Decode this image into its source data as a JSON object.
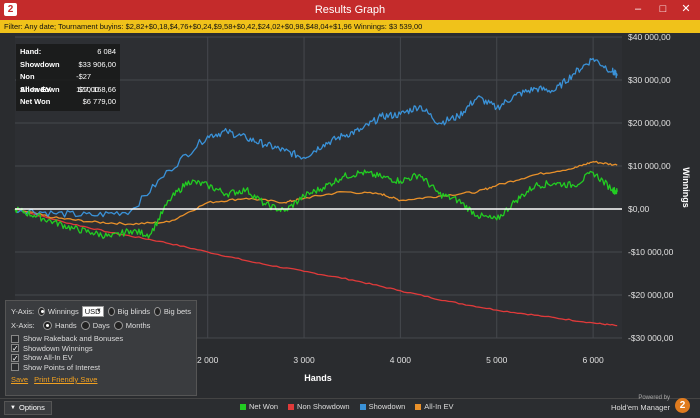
{
  "window": {
    "app_icon": "2",
    "title": "Results Graph",
    "controls": [
      "–",
      "□",
      "✕"
    ]
  },
  "filter": {
    "text": "Filter: Any date; Tournament buyins: $2,82+$0,18,$4,76+$0,24,$9,58+$0,42,$24,02+$0,98,$48,04+$1,96 Winnings: $3 539,00"
  },
  "stats": [
    {
      "label": "Hand:",
      "value": "6 084"
    },
    {
      "label": "Showdown",
      "value": "$33 906,00"
    },
    {
      "label": "Non Showdown",
      "value": "-$27 127,00"
    },
    {
      "label": "All-In EV",
      "value": "$10 168,66"
    },
    {
      "label": "Net Won",
      "value": "$6 779,00"
    }
  ],
  "options": {
    "y_axis_label": "Y-Axis:",
    "y_winnings": "Winnings",
    "currency": "USD",
    "y_big_blinds": "Big blinds",
    "y_big_bets": "Big bets",
    "x_axis_label": "X-Axis:",
    "x_hands": "Hands",
    "x_days": "Days",
    "x_months": "Months",
    "checks": [
      {
        "label": "Show Rakeback and Bonuses",
        "checked": false
      },
      {
        "label": "Showdown Winnings",
        "checked": true
      },
      {
        "label": "Show All-In EV",
        "checked": true
      },
      {
        "label": "Show Points of Interest",
        "checked": false
      }
    ],
    "save": "Save",
    "print": "Print Friendly Save"
  },
  "footer": {
    "options_button": "Options",
    "powered_by": "Powered by",
    "brand_name": "Hold'em Manager",
    "brand_logo": "2"
  },
  "colors": {
    "net_won": "#22cc22",
    "non_showdown": "#e03a3a",
    "showdown": "#3a92d8",
    "allin_ev": "#e8902a",
    "zero_line": "#ffffff"
  },
  "chart_data": {
    "type": "line",
    "xlabel": "Hands",
    "ylabel": "Winnings",
    "xlim": [
      0,
      6300
    ],
    "ylim": [
      -30000,
      40000
    ],
    "x_ticks": [
      2000,
      3000,
      4000,
      5000,
      6000
    ],
    "x_tick_labels": [
      "2 000",
      "3 000",
      "4 000",
      "5 000",
      "6 000"
    ],
    "y_ticks": [
      -30000,
      -20000,
      -10000,
      0,
      10000,
      20000,
      30000,
      40000
    ],
    "y_tick_labels": [
      "-$30 000,00",
      "-$20 000,00",
      "-$10 000,00",
      "$0,00",
      "$10 000,00",
      "$20 000,00",
      "$30 000,00",
      "$40 000,00"
    ],
    "grid": true,
    "legend_position": "bottom",
    "series": [
      {
        "name": "Net Won",
        "color": "#22cc22",
        "x": [
          0,
          200,
          400,
          600,
          800,
          1000,
          1200,
          1400,
          1600,
          1800,
          2000,
          2200,
          2400,
          2600,
          2800,
          3000,
          3200,
          3400,
          3600,
          3800,
          4000,
          4200,
          4400,
          4600,
          4800,
          5000,
          5200,
          5400,
          5600,
          5800,
          6000,
          6200,
          6250
        ],
        "y": [
          0,
          -1500,
          -3000,
          -4500,
          -5500,
          -6500,
          -5000,
          -6000,
          2000,
          6500,
          5500,
          3500,
          4500,
          1000,
          -500,
          3000,
          5000,
          7500,
          8500,
          7500,
          6500,
          8000,
          3500,
          2000,
          -1500,
          -2500,
          2000,
          5500,
          6000,
          5500,
          8500,
          4500,
          4000
        ]
      },
      {
        "name": "Non Showdown",
        "color": "#e03a3a",
        "x": [
          0,
          500,
          1000,
          1500,
          2000,
          2500,
          3000,
          3500,
          4000,
          4500,
          5000,
          5500,
          6000,
          6250
        ],
        "y": [
          0,
          -3000,
          -5500,
          -7500,
          -10000,
          -12500,
          -14500,
          -16500,
          -19000,
          -21500,
          -23500,
          -25000,
          -26500,
          -27127
        ]
      },
      {
        "name": "Showdown",
        "color": "#3a92d8",
        "x": [
          0,
          400,
          800,
          1200,
          1600,
          2000,
          2200,
          2400,
          2600,
          2800,
          3000,
          3200,
          3400,
          3600,
          3800,
          4000,
          4200,
          4400,
          4600,
          4800,
          5000,
          5200,
          5400,
          5600,
          5800,
          6000,
          6200,
          6250
        ],
        "y": [
          0,
          -1000,
          -1500,
          -500,
          9000,
          17000,
          18000,
          16500,
          15000,
          13500,
          12000,
          15000,
          17000,
          18500,
          21500,
          22000,
          24000,
          20000,
          21500,
          26000,
          23500,
          26500,
          28000,
          27500,
          31500,
          35000,
          32000,
          31000
        ]
      },
      {
        "name": "All-In EV",
        "color": "#e8902a",
        "x": [
          0,
          400,
          800,
          1200,
          1600,
          2000,
          2400,
          2800,
          3000,
          3400,
          3800,
          4000,
          4400,
          4800,
          5000,
          5400,
          5800,
          6000,
          6250
        ],
        "y": [
          0,
          -2000,
          -3000,
          -3500,
          -3000,
          1500,
          2500,
          1500,
          2500,
          4000,
          3500,
          2000,
          3000,
          4000,
          5500,
          8000,
          9500,
          11000,
          10200
        ]
      }
    ]
  }
}
